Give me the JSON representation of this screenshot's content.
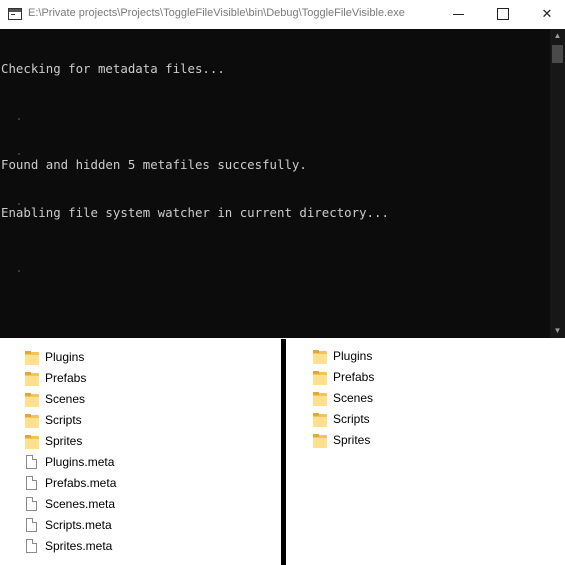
{
  "console": {
    "title": "E:\\Private projects\\Projects\\ToggleFileVisible\\bin\\Debug\\ToggleFileVisible.exe",
    "lines": [
      "Checking for metadata files...",
      "",
      "Found and hidden 5 metafiles succesfully.",
      "Enabling file system watcher in current directory..."
    ],
    "icon": "console-window-icon",
    "background": "#0c0c0c",
    "text_color": "#cccccc"
  },
  "window_controls": {
    "minimize_icon": "minimize-icon",
    "maximize_icon": "maximize-icon",
    "close_glyph": "✕"
  },
  "left_pane": {
    "items": [
      {
        "name": "Plugins",
        "type": "folder"
      },
      {
        "name": "Prefabs",
        "type": "folder"
      },
      {
        "name": "Scenes",
        "type": "folder"
      },
      {
        "name": "Scripts",
        "type": "folder"
      },
      {
        "name": "Sprites",
        "type": "folder"
      },
      {
        "name": "Plugins.meta",
        "type": "file"
      },
      {
        "name": "Prefabs.meta",
        "type": "file"
      },
      {
        "name": "Scenes.meta",
        "type": "file"
      },
      {
        "name": "Scripts.meta",
        "type": "file"
      },
      {
        "name": "Sprites.meta",
        "type": "file"
      }
    ]
  },
  "right_pane": {
    "items": [
      {
        "name": "Plugins",
        "type": "folder"
      },
      {
        "name": "Prefabs",
        "type": "folder"
      },
      {
        "name": "Scenes",
        "type": "folder"
      },
      {
        "name": "Scripts",
        "type": "folder"
      },
      {
        "name": "Sprites",
        "type": "folder"
      }
    ]
  },
  "colors": {
    "folder": "#ffe08f",
    "divider": "#000000"
  }
}
